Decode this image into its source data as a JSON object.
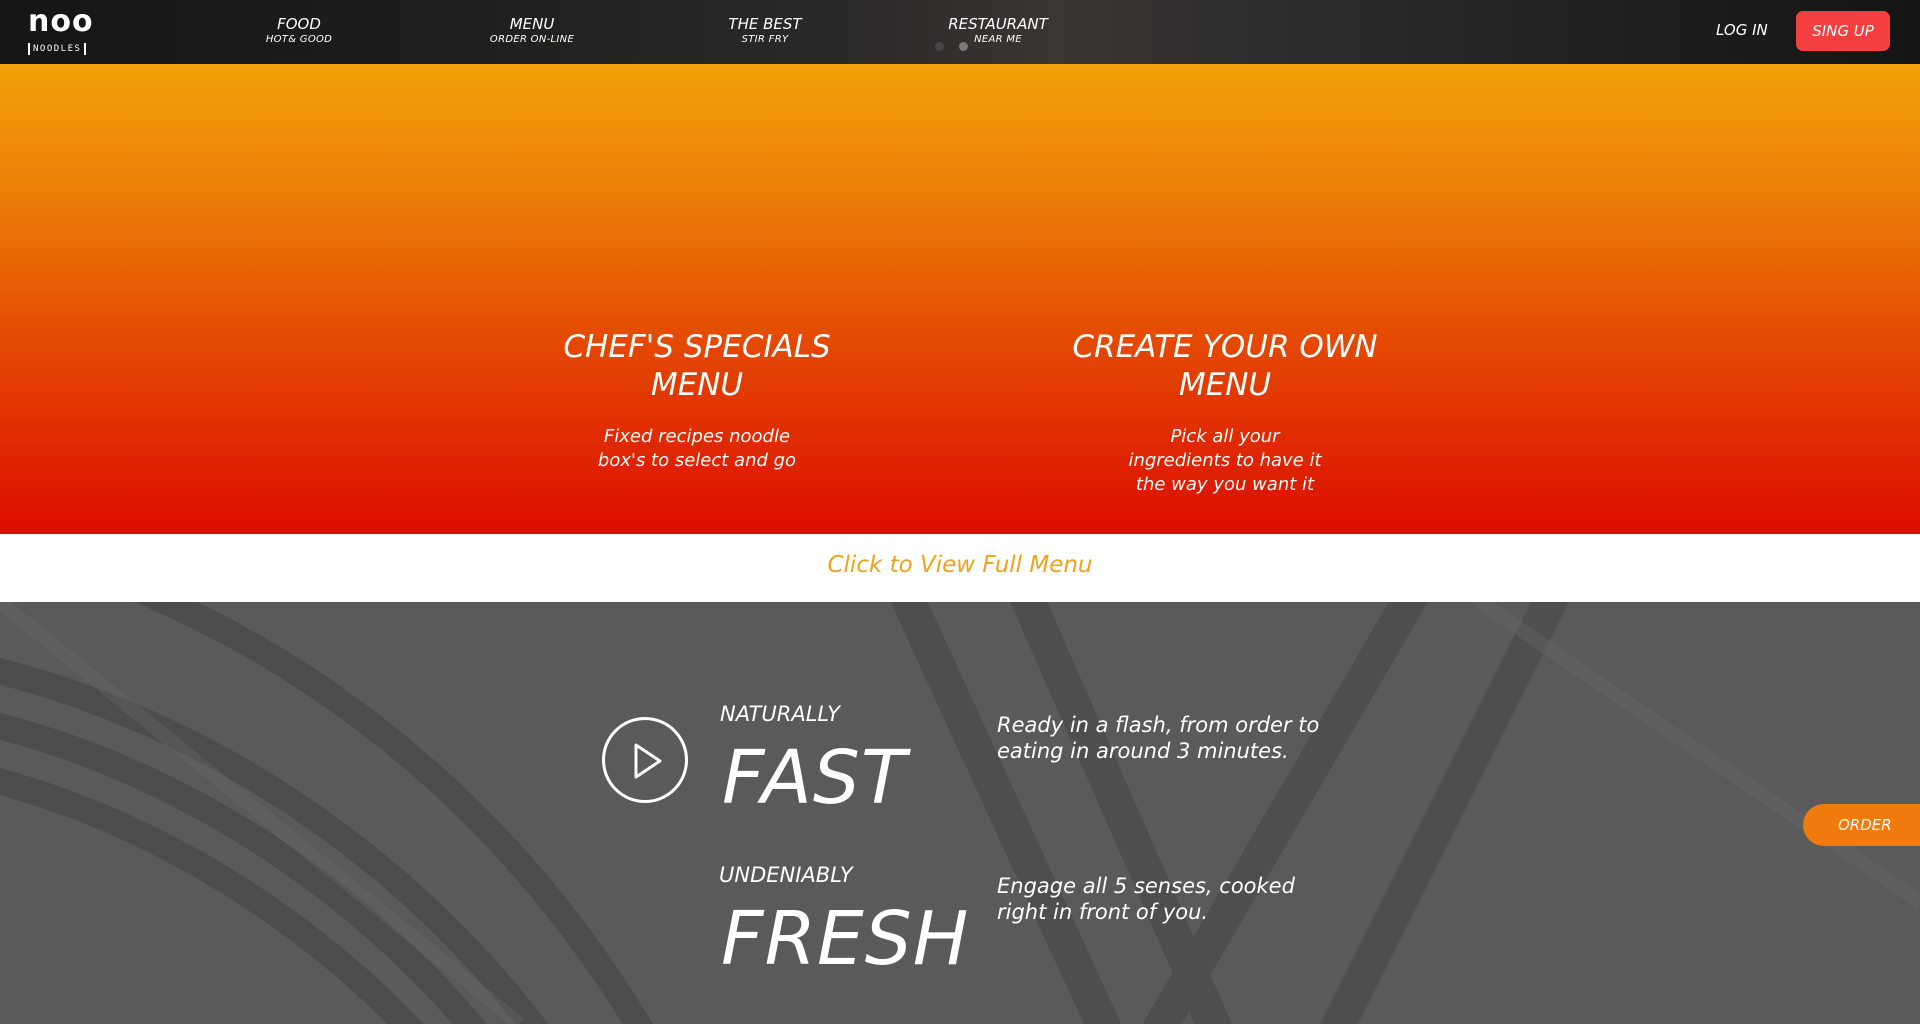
{
  "header": {
    "logo_main": "noo",
    "logo_sub": "NOODLES",
    "nav": [
      {
        "title": "FOOD",
        "sub": "HOT& GOOD"
      },
      {
        "title": "MENU",
        "sub": "ORDER ON-LINE"
      },
      {
        "title": "THE BEST",
        "sub": "STIR FRY"
      },
      {
        "title": "RESTAURANT",
        "sub": "NEAR ME"
      }
    ],
    "login": "LOG IN",
    "signup": "SING UP",
    "slider_dots": 2,
    "active_dot": 1
  },
  "hero": {
    "left": {
      "title": "CHEF'S SPECIALS MENU",
      "desc": "Fixed recipes noodle box's to select and go"
    },
    "right": {
      "title": "CREATE YOUR OWN MENU",
      "desc": "Pick all your ingredients to have it the way you want it"
    }
  },
  "menu_strip": {
    "link": "Click to View Full Menu"
  },
  "features": [
    {
      "lead": "NATURALLY",
      "big": "FAST",
      "desc": "Ready in a flash, from order to eating in around 3 minutes."
    },
    {
      "lead": "UNDENIABLY",
      "big": "FRESH",
      "desc": "Engage all 5 senses, cooked right in front of you."
    }
  ],
  "order_tab": "ORDER",
  "colors": {
    "signup": "#f33f3f",
    "hero_top": "#f2a20a",
    "hero_bottom": "#db0d00",
    "menu_link": "#f0a21a",
    "order_tab": "#f07a0b",
    "feature_bg": "#5a5a5a"
  },
  "icons": {
    "play": "play-icon"
  }
}
